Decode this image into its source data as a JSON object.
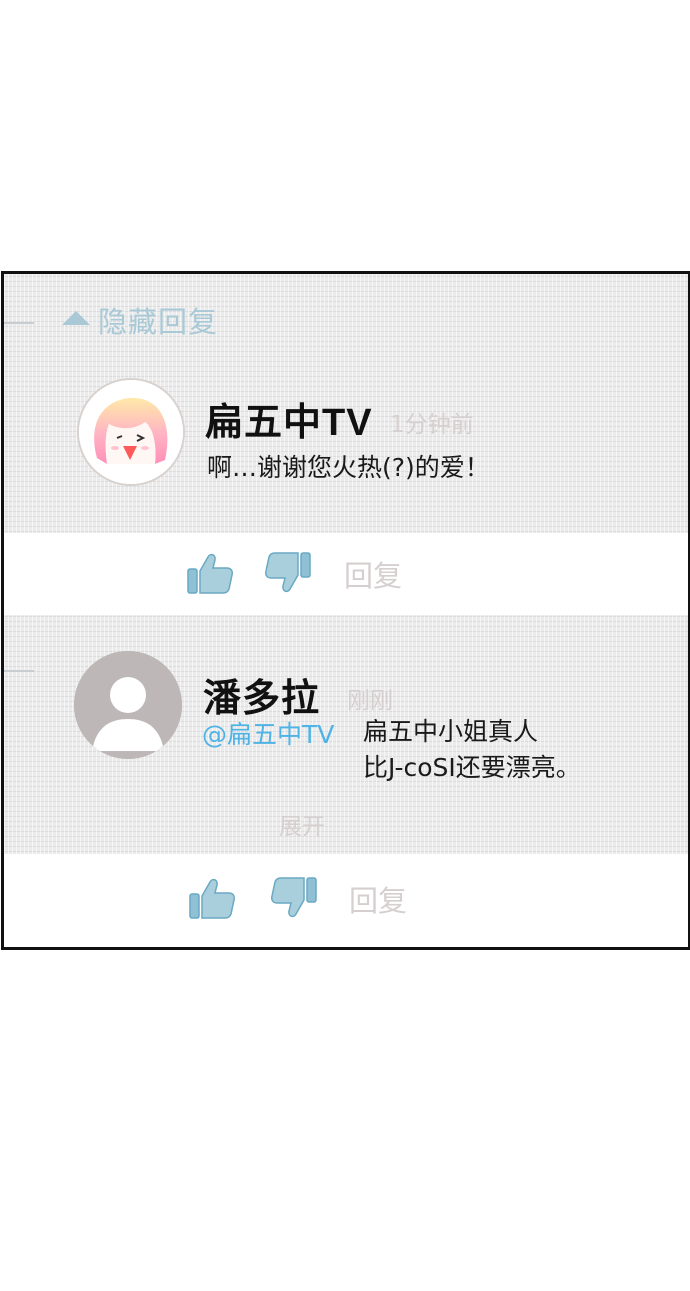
{
  "thread": {
    "hide_replies_label": "隐藏回复",
    "accent_color": "#a9c9d6",
    "mention_color": "#4fb3e6"
  },
  "comments": [
    {
      "author": "扁五中TV",
      "time": "1分钟前",
      "lines": [
        "啊…谢谢您火热(?)的爱！"
      ],
      "avatar": "pink-haired-girl-avatar",
      "actions": {
        "like_icon": "thumbs-up-icon",
        "dislike_icon": "thumbs-down-icon",
        "reply_label": "回复"
      }
    },
    {
      "author": "潘多拉",
      "time": "刚刚",
      "mention": "@扁五中TV",
      "lines": [
        "扁五中小姐真人",
        "比J-coSI还要漂亮。"
      ],
      "expand_label": "展开",
      "avatar": "default-user-avatar",
      "actions": {
        "like_icon": "thumbs-up-icon",
        "dislike_icon": "thumbs-down-icon",
        "reply_label": "回复"
      }
    }
  ]
}
